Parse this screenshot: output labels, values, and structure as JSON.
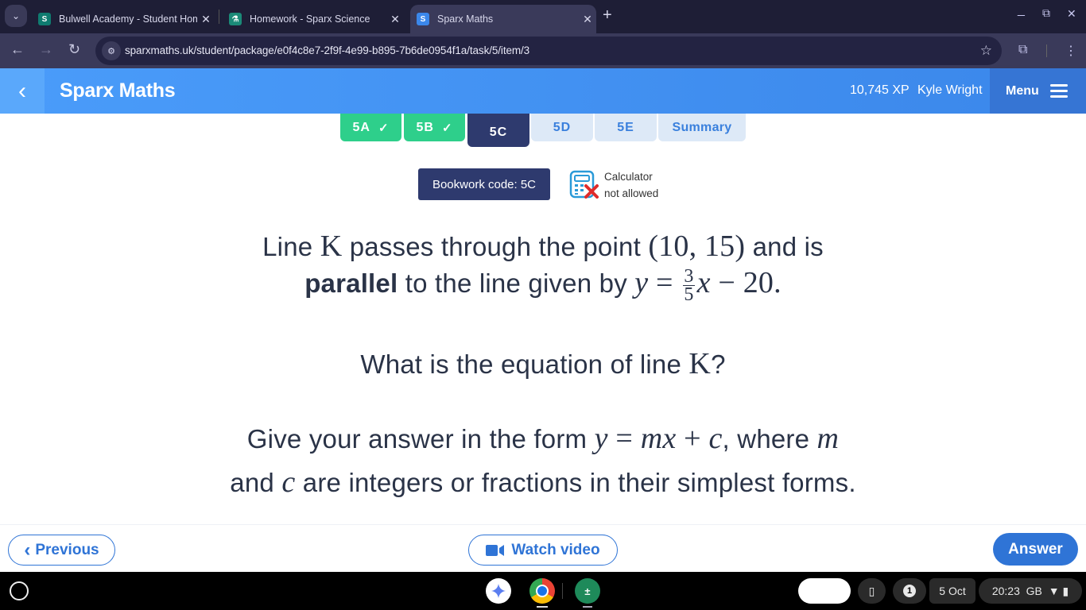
{
  "browser": {
    "tabs": [
      {
        "title": "Bulwell Academy - Student Hom",
        "favicon": "sharepoint-icon",
        "favicon_color": "#0f7b70",
        "active": false
      },
      {
        "title": "Homework - Sparx Science",
        "favicon": "flask-icon",
        "favicon_color": "#1b8a78",
        "active": false
      },
      {
        "title": "Sparx Maths",
        "favicon": "sparx-s-icon",
        "favicon_color": "#3b87ea",
        "active": true
      }
    ],
    "favicon_letters": {
      "sharepoint": "S",
      "sparx": "S",
      "flask": "⚗"
    },
    "url": "sparxmaths.uk/student/package/e0f4c8e7-2f9f-4e99-b895-7b6de0954f1a/task/5/item/3",
    "icons": {
      "back": "←",
      "forward": "→",
      "reload": "↻",
      "star": "☆",
      "extensions": "⧉",
      "more": "⋮",
      "tab_dropdown": "⌄",
      "new_tab": "+",
      "close": "✕",
      "minimize": "_",
      "restore": "⧉",
      "site_info": "⚙"
    }
  },
  "header": {
    "brand": "Sparx Maths",
    "back_icon": "‹",
    "xp": "10,745 XP",
    "user": "Kyle Wright",
    "menu_label": "Menu"
  },
  "task_tabs": [
    {
      "label": "5A",
      "state": "done"
    },
    {
      "label": "5B",
      "state": "done"
    },
    {
      "label": "5C",
      "state": "current"
    },
    {
      "label": "5D",
      "state": "todo"
    },
    {
      "label": "5E",
      "state": "todo"
    },
    {
      "label": "Summary",
      "state": "todo"
    }
  ],
  "check_icon": "✓",
  "bookwork": {
    "label": "Bookwork code: 5C"
  },
  "calculator": {
    "line1": "Calculator",
    "line2": "not allowed"
  },
  "question": {
    "line1_a": "Line ",
    "line1_K": "K",
    "line1_b": " passes through the point ",
    "point": "(10, 15)",
    "line1_c": " and is",
    "line2_bold": "parallel",
    "line2_a": " to the line given by ",
    "eq_y": "y",
    "eq_eq": " = ",
    "frac_num": "3",
    "frac_den": "5",
    "eq_x": "x",
    "eq_rest": " − 20.",
    "line3_a": "What is the equation of line ",
    "line3_K": "K",
    "line3_b": "?",
    "line4_a": "Give your answer in the form ",
    "form_y": "y",
    "form_eq": " = ",
    "form_mx": "mx",
    "form_plus": " + ",
    "form_c": "c",
    "line4_b": ", where ",
    "line4_m": "m",
    "line5_a": "and ",
    "line5_c": "c",
    "line5_b": " are integers or fractions in their simplest forms."
  },
  "footer": {
    "previous": "Previous",
    "previous_icon": "‹",
    "watch_video": "Watch video",
    "answer": "Answer"
  },
  "shelf": {
    "apps": [
      "gemini",
      "chrome",
      "calculator"
    ],
    "notification_count": "1",
    "date": "5 Oct",
    "time": "20:23",
    "locale": "GB"
  }
}
